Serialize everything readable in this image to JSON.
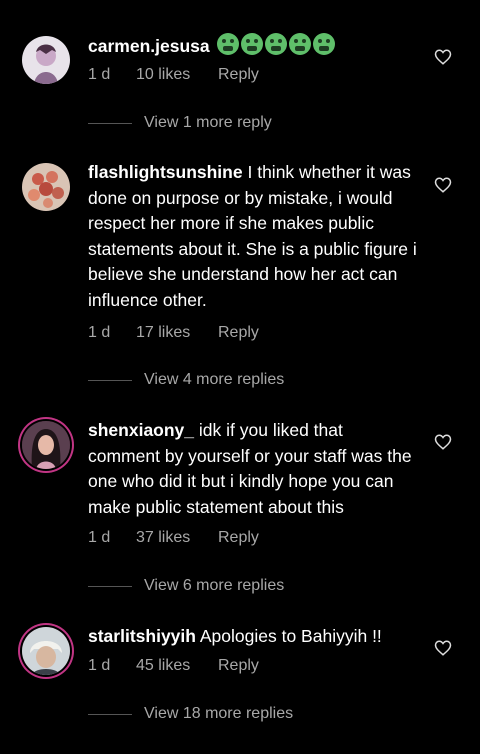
{
  "comments": [
    {
      "username": "carmen.jesusa",
      "text": "",
      "emojis": [
        "nauseated-face",
        "nauseated-face",
        "nauseated-face",
        "nauseated-face",
        "nauseated-face"
      ],
      "time": "1 d",
      "likes": "10 likes",
      "reply": "Reply",
      "view_more": "View 1 more reply"
    },
    {
      "username": "flashlightsunshine",
      "text": "I think whether it was done on purpose or by mistake, i would respect her more if she makes public statements about it. She is a public figure i believe she understand how her act can influence other.",
      "time": "1 d",
      "likes": "17 likes",
      "reply": "Reply",
      "view_more": "View 4 more replies"
    },
    {
      "username": "shenxiaony_",
      "text": "idk if you liked that comment by yourself or your staff was the one who did it but i kindly hope you can make public statement about this",
      "time": "1 d",
      "likes": "37 likes",
      "reply": "Reply",
      "view_more": "View 6 more replies"
    },
    {
      "username": "starlitshiyyih",
      "text": "Apologies to Bahiyyih !!",
      "time": "1 d",
      "likes": "45 likes",
      "reply": "Reply",
      "view_more": "View 18 more replies"
    }
  ],
  "colors": {
    "background": "#000000",
    "secondary_text": "#a8a8a8",
    "story_ring": "#c13584",
    "emoji_green": "#5fbf6a"
  }
}
